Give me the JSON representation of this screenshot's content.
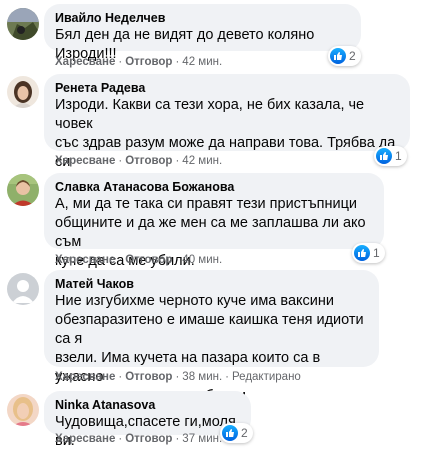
{
  "comments": [
    {
      "author": "Ивайло Неделчев",
      "text": "Бял ден да не видят до девето коляно Изроди!!!",
      "like_label": "Харесване",
      "reply_label": "Отговор",
      "time": "42 мин.",
      "reactions": "2"
    },
    {
      "author": "Ренета Радева",
      "text": "Изроди. Какви са тези хора, не бих казала, че човек\nсъс здрав разум може да направи това. Трябва да си\nполучат заслуженото.",
      "emoji": "angry-face-icon",
      "like_label": "Харесване",
      "reply_label": "Отговор",
      "time": "42 мин.",
      "reactions": "1"
    },
    {
      "author": "Славка Атанасова Божанова",
      "text": "А, ми да те така си правят тези пристъпници\nобщините и да же мен са ме заплашва ли ако съм\nкуче да са ме убили.",
      "like_label": "Харесване",
      "reply_label": "Отговор",
      "time": "40 мин.",
      "reactions": "1"
    },
    {
      "author": "Матей Чаков",
      "text": "Ние изгубихме черното куче има ваксини\nобезпаразитено е имаше каишка теня идиоти са я\nвзели. Има кучета на пазара които са в ужасно\nсъстояние крастави и болни",
      "like_label": "Харесване",
      "reply_label": "Отговор",
      "time": "38 мин.",
      "edited": "Редактирано"
    },
    {
      "author": "Ninka Atanasova",
      "text": "Чудовища,спасете ги,моля ви.",
      "like_label": "Харесване",
      "reply_label": "Отговор",
      "time": "37 мин.",
      "reactions": "2"
    }
  ],
  "colors": {
    "bubble": "#f0f2f5",
    "meta_text": "#65676b",
    "like_blue": "#1877f2"
  }
}
